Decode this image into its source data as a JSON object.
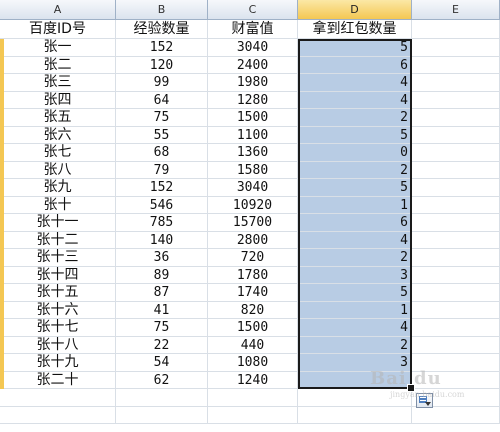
{
  "columns": [
    "A",
    "B",
    "C",
    "D",
    "E"
  ],
  "selected_column": "D",
  "headers": {
    "a": "百度ID号",
    "b": "经验数量",
    "c": "财富值",
    "d": "拿到红包数量"
  },
  "rows": [
    {
      "a": "张一",
      "b": "152",
      "c": "3040",
      "d": "5"
    },
    {
      "a": "张二",
      "b": "120",
      "c": "2400",
      "d": "6"
    },
    {
      "a": "张三",
      "b": "99",
      "c": "1980",
      "d": "4"
    },
    {
      "a": "张四",
      "b": "64",
      "c": "1280",
      "d": "4"
    },
    {
      "a": "张五",
      "b": "75",
      "c": "1500",
      "d": "2"
    },
    {
      "a": "张六",
      "b": "55",
      "c": "1100",
      "d": "5"
    },
    {
      "a": "张七",
      "b": "68",
      "c": "1360",
      "d": "0"
    },
    {
      "a": "张八",
      "b": "79",
      "c": "1580",
      "d": "2"
    },
    {
      "a": "张九",
      "b": "152",
      "c": "3040",
      "d": "5"
    },
    {
      "a": "张十",
      "b": "546",
      "c": "10920",
      "d": "1"
    },
    {
      "a": "张十一",
      "b": "785",
      "c": "15700",
      "d": "6"
    },
    {
      "a": "张十二",
      "b": "140",
      "c": "2800",
      "d": "4"
    },
    {
      "a": "张十三",
      "b": "36",
      "c": "720",
      "d": "2"
    },
    {
      "a": "张十四",
      "b": "89",
      "c": "1780",
      "d": "3"
    },
    {
      "a": "张十五",
      "b": "87",
      "c": "1740",
      "d": "5"
    },
    {
      "a": "张十六",
      "b": "41",
      "c": "820",
      "d": "1"
    },
    {
      "a": "张十七",
      "b": "75",
      "c": "1500",
      "d": "4"
    },
    {
      "a": "张十八",
      "b": "22",
      "c": "440",
      "d": "2"
    },
    {
      "a": "张十九",
      "b": "54",
      "c": "1080",
      "d": "3"
    },
    {
      "a": "张二十",
      "b": "62",
      "c": "1240",
      "d": ""
    }
  ],
  "autofill_options_icon": "autofill-options-icon",
  "watermark": {
    "text": "Bai du",
    "sub": "jingyan.baidu.com"
  },
  "colors": {
    "selection_fill": "#b8cce4",
    "selected_header": "#f4c753",
    "selection_border": "#1a1a1a"
  }
}
